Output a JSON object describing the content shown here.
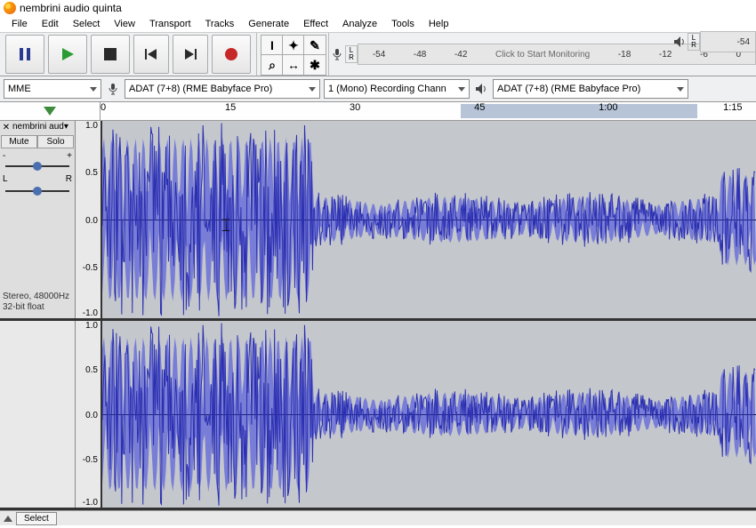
{
  "title": "nembrini audio quinta",
  "menu": [
    "File",
    "Edit",
    "Select",
    "View",
    "Transport",
    "Tracks",
    "Generate",
    "Effect",
    "Analyze",
    "Tools",
    "Help"
  ],
  "transport": {
    "pause": "pause",
    "play": "play",
    "stop": "stop",
    "skip_start": "skip-start",
    "skip_end": "skip-end",
    "record": "record"
  },
  "tools": {
    "select": "I",
    "envelope": "✦",
    "draw": "✎",
    "zoom": "⌕",
    "trim": "↔",
    "silence": "✱"
  },
  "meter": {
    "L": "L",
    "R": "R",
    "ticks": [
      "-54",
      "-48",
      "-42",
      "Click to Start Monitoring",
      "-18",
      "-12",
      "-6",
      "0"
    ],
    "out_ticks": [
      "-54"
    ]
  },
  "devices": {
    "host": "MME",
    "rec": "ADAT (7+8) (RME Babyface Pro)",
    "channels": "1 (Mono) Recording Chann",
    "play": "ADAT (7+8) (RME Babyface Pro)"
  },
  "ruler": {
    "ticks": [
      "0",
      "15",
      "30",
      "45",
      "1:00",
      "1:15"
    ]
  },
  "track": {
    "name": "nembrini aud",
    "mute": "Mute",
    "solo": "Solo",
    "gain_minus": "-",
    "gain_plus": "+",
    "pan_l": "L",
    "pan_r": "R",
    "format_line1": "Stereo, 48000Hz",
    "format_line2": "32-bit float"
  },
  "amp": {
    "p10": "1.0",
    "p05": "0.5",
    "z": "0.0",
    "n05": "-0.5",
    "n10": "-1.0"
  },
  "bottom": {
    "select": "Select"
  }
}
